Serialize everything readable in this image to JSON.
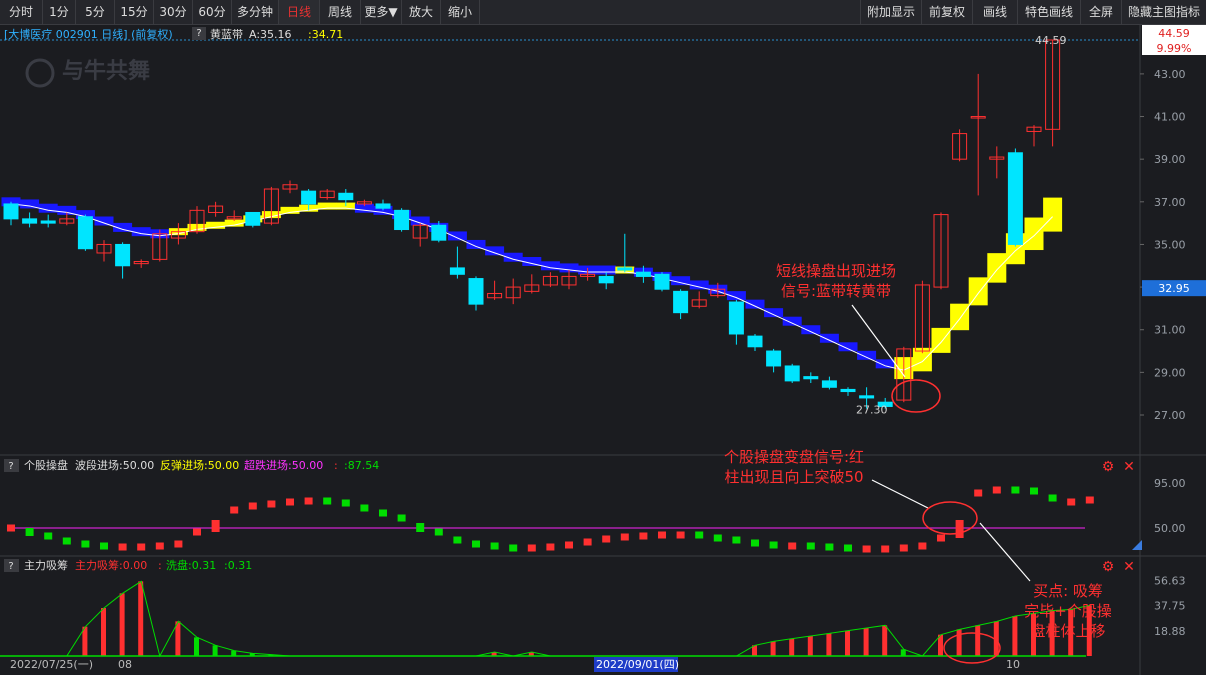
{
  "toolbar": {
    "left": [
      "分时",
      "1分",
      "5分",
      "15分",
      "30分",
      "60分",
      "多分钟",
      "日线",
      "周线",
      "更多▼",
      "放大",
      "缩小"
    ],
    "active": "日线",
    "right": [
      "附加显示",
      "前复权",
      "画线",
      "特色画线",
      "全屏",
      "隐藏主图指标"
    ]
  },
  "header": {
    "stock": "[大博医疗 002901 日线] (前复权)",
    "indicator": "黄蓝带",
    "a_label": "A:35.16",
    "a2_label": ":34.71",
    "watermark": "与牛共舞"
  },
  "price_axis": {
    "ticks": [
      "43.00",
      "41.00",
      "39.00",
      "37.00",
      "35.00",
      "33.00",
      "31.00",
      "29.00",
      "27.00"
    ],
    "tick_values": [
      43,
      41,
      39,
      37,
      35,
      33,
      31,
      29,
      27
    ],
    "top_label": "44.59",
    "pct_label": "9.99%",
    "cur_label": "32.95",
    "cur_value": 32.95,
    "high_label": "44.59",
    "low_label": "27.30"
  },
  "panel2": {
    "title": "个股操盘",
    "l1": "波段进场:50.00",
    "l2": "反弹进场:50.00",
    "l3": "超跌进场:50.00",
    "l4": ":87.54",
    "ticks": [
      "95.00",
      "50.00"
    ]
  },
  "panel3": {
    "title": "主力吸筹",
    "l1": "主力吸筹:0.00",
    "l2": "洗盘:0.31",
    "l3": ":0.31",
    "ticks": [
      "56.63",
      "37.75",
      "18.88"
    ]
  },
  "x_axis": {
    "left_date": "2022/07/25(一)",
    "mid1": "08",
    "mid_date": "2022/09/01(四)",
    "mid2": "10"
  },
  "annotations": {
    "a1": [
      "短线操盘出现进场",
      "信号:蓝带转黄带"
    ],
    "a2": [
      "个股操盘变盘信号:红",
      "柱出现且向上突破50"
    ],
    "a3": [
      "买点: 吸筹",
      "完毕+个股操",
      "盘柱体上移"
    ]
  },
  "colors": {
    "up": "#ff3030",
    "down": "#00e5ff",
    "yellow": "#ffff00",
    "blue": "#1818ff",
    "green": "#00dd00",
    "magenta": "#cc22cc"
  },
  "chart_data": {
    "type": "candlestick",
    "candles": [
      {
        "o": 36.9,
        "c": 36.2,
        "h": 37.0,
        "l": 35.9
      },
      {
        "o": 36.2,
        "c": 36.0,
        "h": 36.5,
        "l": 35.8
      },
      {
        "o": 36.1,
        "c": 36.0,
        "h": 36.4,
        "l": 35.8
      },
      {
        "o": 36.0,
        "c": 36.2,
        "h": 36.5,
        "l": 35.9
      },
      {
        "o": 36.3,
        "c": 34.8,
        "h": 36.4,
        "l": 34.7
      },
      {
        "o": 34.6,
        "c": 35.0,
        "h": 35.2,
        "l": 34.2
      },
      {
        "o": 35.0,
        "c": 34.0,
        "h": 35.1,
        "l": 33.4
      },
      {
        "o": 34.1,
        "c": 34.2,
        "h": 34.3,
        "l": 33.9
      },
      {
        "o": 34.3,
        "c": 35.5,
        "h": 35.7,
        "l": 34.2
      },
      {
        "o": 35.3,
        "c": 35.6,
        "h": 36.0,
        "l": 35.0
      },
      {
        "o": 35.6,
        "c": 36.6,
        "h": 36.8,
        "l": 35.5
      },
      {
        "o": 36.5,
        "c": 36.8,
        "h": 37.0,
        "l": 36.3
      },
      {
        "o": 36.2,
        "c": 36.3,
        "h": 36.6,
        "l": 36.1
      },
      {
        "o": 36.5,
        "c": 35.9,
        "h": 36.5,
        "l": 35.8
      },
      {
        "o": 36.0,
        "c": 37.6,
        "h": 37.7,
        "l": 35.9
      },
      {
        "o": 37.6,
        "c": 37.8,
        "h": 38.0,
        "l": 37.4
      },
      {
        "o": 37.5,
        "c": 36.9,
        "h": 37.6,
        "l": 36.6
      },
      {
        "o": 37.2,
        "c": 37.5,
        "h": 37.6,
        "l": 37.1
      },
      {
        "o": 37.4,
        "c": 37.1,
        "h": 37.6,
        "l": 36.8
      },
      {
        "o": 36.9,
        "c": 37.0,
        "h": 37.1,
        "l": 36.8
      },
      {
        "o": 36.9,
        "c": 36.7,
        "h": 37.1,
        "l": 36.6
      },
      {
        "o": 36.6,
        "c": 35.7,
        "h": 36.7,
        "l": 35.6
      },
      {
        "o": 35.3,
        "c": 35.9,
        "h": 36.0,
        "l": 34.9
      },
      {
        "o": 35.9,
        "c": 35.2,
        "h": 36.1,
        "l": 35.1
      },
      {
        "o": 33.9,
        "c": 33.6,
        "h": 34.9,
        "l": 33.4
      },
      {
        "o": 33.4,
        "c": 32.2,
        "h": 33.5,
        "l": 31.9
      },
      {
        "o": 32.5,
        "c": 32.7,
        "h": 33.3,
        "l": 32.4
      },
      {
        "o": 32.5,
        "c": 33.0,
        "h": 33.4,
        "l": 32.2
      },
      {
        "o": 32.8,
        "c": 33.1,
        "h": 33.6,
        "l": 32.7
      },
      {
        "o": 33.1,
        "c": 33.5,
        "h": 33.7,
        "l": 33.0
      },
      {
        "o": 33.1,
        "c": 33.5,
        "h": 33.8,
        "l": 32.9
      },
      {
        "o": 33.5,
        "c": 33.6,
        "h": 33.9,
        "l": 33.3
      },
      {
        "o": 33.5,
        "c": 33.2,
        "h": 33.7,
        "l": 32.9
      },
      {
        "o": 33.9,
        "c": 33.8,
        "h": 35.5,
        "l": 33.7
      },
      {
        "o": 33.7,
        "c": 33.5,
        "h": 34.0,
        "l": 33.2
      },
      {
        "o": 33.6,
        "c": 32.9,
        "h": 33.7,
        "l": 32.8
      },
      {
        "o": 32.8,
        "c": 31.8,
        "h": 32.9,
        "l": 31.5
      },
      {
        "o": 32.1,
        "c": 32.4,
        "h": 32.8,
        "l": 32.0
      },
      {
        "o": 32.6,
        "c": 32.9,
        "h": 33.2,
        "l": 32.5
      },
      {
        "o": 32.3,
        "c": 30.8,
        "h": 32.4,
        "l": 30.3
      },
      {
        "o": 30.7,
        "c": 30.2,
        "h": 30.8,
        "l": 30.0
      },
      {
        "o": 30.0,
        "c": 29.3,
        "h": 30.1,
        "l": 29.0
      },
      {
        "o": 29.3,
        "c": 28.6,
        "h": 29.4,
        "l": 28.5
      },
      {
        "o": 28.8,
        "c": 28.7,
        "h": 29.0,
        "l": 28.5
      },
      {
        "o": 28.6,
        "c": 28.3,
        "h": 28.8,
        "l": 28.2
      },
      {
        "o": 28.2,
        "c": 28.1,
        "h": 28.3,
        "l": 27.9
      },
      {
        "o": 27.9,
        "c": 27.8,
        "h": 28.3,
        "l": 27.3
      },
      {
        "o": 27.6,
        "c": 27.4,
        "h": 27.8,
        "l": 27.3
      },
      {
        "o": 27.7,
        "c": 30.1,
        "h": 30.2,
        "l": 27.6
      },
      {
        "o": 30.0,
        "c": 33.1,
        "h": 33.3,
        "l": 29.9
      },
      {
        "o": 33.0,
        "c": 36.4,
        "h": 36.5,
        "l": 32.9
      },
      {
        "o": 39.0,
        "c": 40.2,
        "h": 40.4,
        "l": 38.9
      },
      {
        "o": 41.0,
        "c": 41.0,
        "h": 43.0,
        "l": 37.3
      },
      {
        "o": 39.0,
        "c": 39.1,
        "h": 39.6,
        "l": 38.1
      },
      {
        "o": 39.3,
        "c": 35.0,
        "h": 39.5,
        "l": 34.9
      },
      {
        "o": 40.3,
        "c": 40.5,
        "h": 40.6,
        "l": 39.6
      },
      {
        "o": 40.4,
        "c": 44.59,
        "h": 44.59,
        "l": 39.6
      }
    ],
    "band": [
      {
        "v": 37.0,
        "c": "blue"
      },
      {
        "v": 36.9,
        "c": "blue"
      },
      {
        "v": 36.7,
        "c": "blue"
      },
      {
        "v": 36.6,
        "c": "blue"
      },
      {
        "v": 36.4,
        "c": "blue"
      },
      {
        "v": 36.1,
        "c": "blue"
      },
      {
        "v": 35.8,
        "c": "blue"
      },
      {
        "v": 35.6,
        "c": "blue"
      },
      {
        "v": 35.5,
        "c": "blue"
      },
      {
        "v": 35.6,
        "c": "yellow"
      },
      {
        "v": 35.8,
        "c": "yellow"
      },
      {
        "v": 35.9,
        "c": "yellow"
      },
      {
        "v": 36.0,
        "c": "yellow"
      },
      {
        "v": 36.2,
        "c": "yellow"
      },
      {
        "v": 36.4,
        "c": "yellow"
      },
      {
        "v": 36.6,
        "c": "yellow"
      },
      {
        "v": 36.7,
        "c": "yellow"
      },
      {
        "v": 36.8,
        "c": "yellow"
      },
      {
        "v": 36.8,
        "c": "yellow"
      },
      {
        "v": 36.7,
        "c": "blue"
      },
      {
        "v": 36.6,
        "c": "blue"
      },
      {
        "v": 36.4,
        "c": "blue"
      },
      {
        "v": 36.1,
        "c": "blue"
      },
      {
        "v": 35.8,
        "c": "blue"
      },
      {
        "v": 35.4,
        "c": "blue"
      },
      {
        "v": 35.0,
        "c": "blue"
      },
      {
        "v": 34.7,
        "c": "blue"
      },
      {
        "v": 34.4,
        "c": "blue"
      },
      {
        "v": 34.2,
        "c": "blue"
      },
      {
        "v": 34.0,
        "c": "blue"
      },
      {
        "v": 33.9,
        "c": "blue"
      },
      {
        "v": 33.8,
        "c": "blue"
      },
      {
        "v": 33.8,
        "c": "blue"
      },
      {
        "v": 33.8,
        "c": "yellow"
      },
      {
        "v": 33.7,
        "c": "blue"
      },
      {
        "v": 33.5,
        "c": "blue"
      },
      {
        "v": 33.3,
        "c": "blue"
      },
      {
        "v": 33.1,
        "c": "blue"
      },
      {
        "v": 32.9,
        "c": "blue"
      },
      {
        "v": 32.6,
        "c": "blue"
      },
      {
        "v": 32.2,
        "c": "blue"
      },
      {
        "v": 31.8,
        "c": "blue"
      },
      {
        "v": 31.4,
        "c": "blue"
      },
      {
        "v": 31.0,
        "c": "blue"
      },
      {
        "v": 30.6,
        "c": "blue"
      },
      {
        "v": 30.2,
        "c": "blue"
      },
      {
        "v": 29.8,
        "c": "blue"
      },
      {
        "v": 29.4,
        "c": "blue"
      },
      {
        "v": 29.2,
        "c": "yellow"
      },
      {
        "v": 29.6,
        "c": "yellow"
      },
      {
        "v": 30.5,
        "c": "yellow"
      },
      {
        "v": 31.6,
        "c": "yellow"
      },
      {
        "v": 32.8,
        "c": "yellow"
      },
      {
        "v": 33.9,
        "c": "yellow"
      },
      {
        "v": 34.8,
        "c": "yellow"
      },
      {
        "v": 35.5,
        "c": "yellow"
      },
      {
        "v": 36.4,
        "c": "yellow"
      }
    ],
    "panel2_values": [
      50,
      42,
      37,
      34,
      32,
      31,
      31,
      31,
      32,
      34,
      46,
      58,
      68,
      72,
      74,
      76,
      77,
      75,
      70,
      65,
      60,
      55,
      46,
      38,
      34,
      32,
      30,
      29,
      30,
      31,
      33,
      36,
      39,
      41,
      42,
      43,
      43,
      40,
      38,
      35,
      33,
      32,
      32,
      31,
      30,
      29,
      29,
      29,
      30,
      32,
      40,
      58,
      85,
      88,
      87,
      80,
      76,
      76,
      78
    ],
    "panel2_midline": 50,
    "panel3_values": [
      0,
      0,
      0,
      0,
      22,
      36,
      47,
      56,
      0,
      26,
      14,
      8,
      4,
      2,
      1,
      0,
      0,
      0,
      0,
      0,
      0,
      0,
      0,
      0,
      0,
      0,
      0,
      0,
      0,
      0,
      0,
      0,
      0,
      0,
      0,
      0,
      0,
      0,
      0,
      0,
      0,
      0,
      0,
      0,
      0,
      0,
      0,
      0,
      0,
      0,
      0,
      0,
      0,
      0,
      0,
      0,
      0,
      0,
      0
    ]
  }
}
